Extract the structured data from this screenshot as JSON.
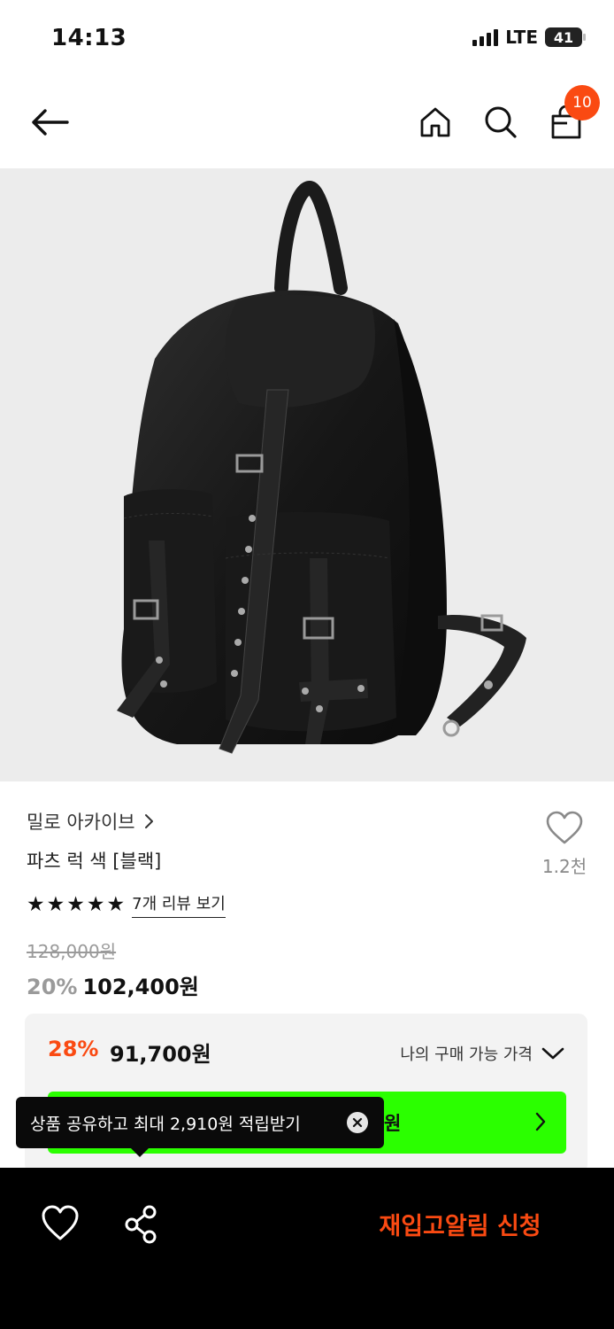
{
  "status_bar": {
    "time": "14:13",
    "network": "LTE",
    "battery": "41"
  },
  "header": {
    "cart_count": "10",
    "icons": [
      "arrow-left-icon",
      "home-icon",
      "search-icon",
      "shopping-bag-icon"
    ]
  },
  "product": {
    "image_alt": "black nylon backpack",
    "brand": "밀로 아카이브",
    "title": "파츠 럭 색 [블랙]",
    "like_count": "1.2천",
    "rating": 5,
    "review_link": "7개 리뷰 보기",
    "original_price": "128,000원",
    "discount": "20%",
    "price": "102,400원"
  },
  "member_price": {
    "discount": "28%",
    "price": "91,700원",
    "toggle_label": "나의 구매 가능 가격",
    "coupon_button_text": "원"
  },
  "tooltip": {
    "text": "상품 공유하고 최대 2,910원 적립받기"
  },
  "bottom_bar": {
    "restock_label": "재입고알림 신청"
  },
  "colors": {
    "accent": "#fa4a12",
    "coupon_green": "#2bff00",
    "image_bg": "#ececec"
  }
}
